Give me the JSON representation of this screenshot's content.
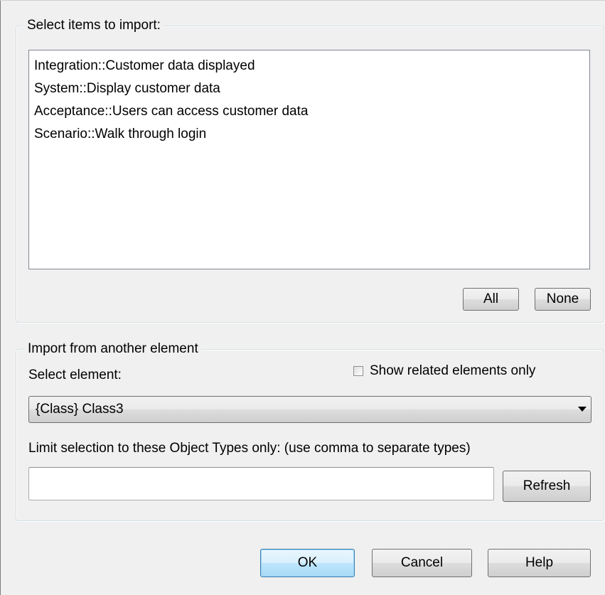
{
  "select_items": {
    "title": "Select items to import:",
    "items": [
      "Integration::Customer data displayed",
      "System::Display customer data",
      "Acceptance::Users can access customer data",
      "Scenario::Walk through login"
    ],
    "all_label": "All",
    "none_label": "None"
  },
  "import_from": {
    "title": "Import from another element",
    "select_element_label": "Select element:",
    "show_related_label": "Show related elements only",
    "show_related_checked": false,
    "selected_element": "{Class} Class3",
    "limit_label": "Limit selection to these Object Types only: (use comma to separate types)",
    "object_types_value": "",
    "refresh_label": "Refresh"
  },
  "footer": {
    "ok_label": "OK",
    "cancel_label": "Cancel",
    "help_label": "Help"
  },
  "icons": {
    "dropdown": "chevron-down-icon"
  },
  "colors": {
    "background": "#f0f0f0",
    "groupbox_border": "#d5dfe5",
    "default_button_border": "#3c7fb1"
  }
}
